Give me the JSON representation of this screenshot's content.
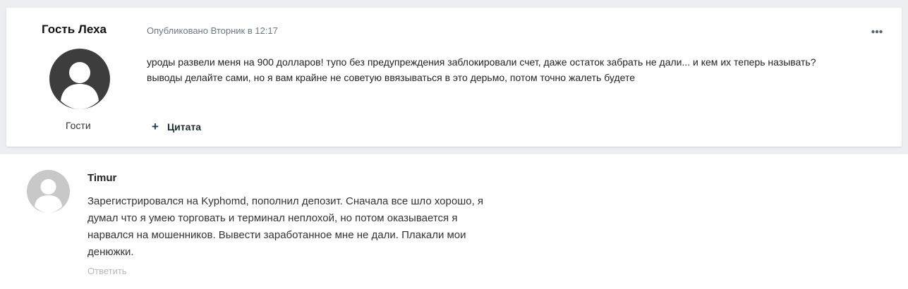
{
  "post": {
    "author_name": "Гость Леха",
    "author_group": "Гости",
    "meta": "Опубликовано Вторник в 12:17",
    "body_lines": [
      "уроды развели меня на 900 долларов! тупо без предупреждения заблокировали счет, даже остаток забрать не дали... и кем их теперь называть?",
      "выводы делайте сами, но я вам крайне не советую ввязываться в это дерьмо, потом точно жалеть будете"
    ],
    "quote_icon": "+",
    "quote_label": "Цитата",
    "more_icon": "ellipsis-icon"
  },
  "comment": {
    "author_name": "Timur",
    "text_lines": [
      "Зарегистрировался на Kyphomd, пополнил депозит. Сначала все шло хорошо, я",
      "думал что я умею торговать и терминал неплохой, но потом оказывается я",
      "нарвался на мошенников. Вывести заработанное мне не дали. Плакали мои",
      "денюжки."
    ],
    "reply_label": "Ответить"
  },
  "colors": {
    "band_background": "#eceef2",
    "avatar_dark": "#3d3d3d",
    "avatar_light": "#c8c8c8",
    "meta_text": "#6d7887",
    "reply_text": "#b8b8b8"
  }
}
